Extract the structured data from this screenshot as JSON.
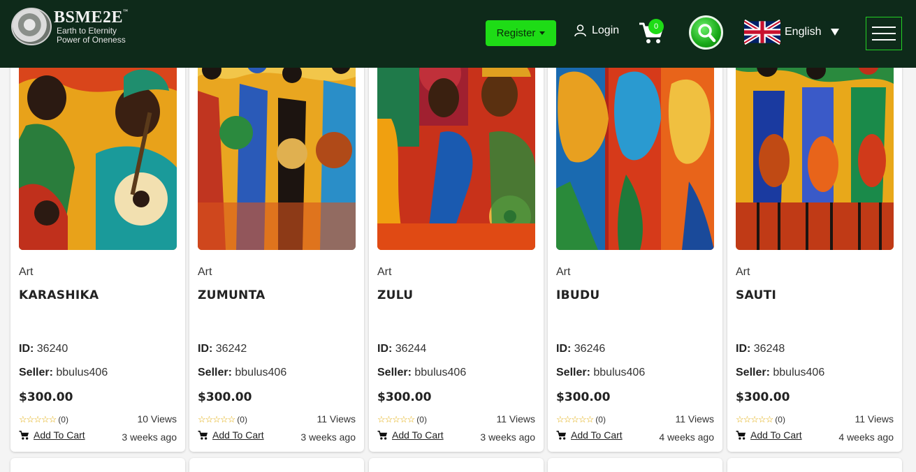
{
  "header": {
    "brand": "BSME2E",
    "tagline_1": "Earth to Eternity",
    "tagline_2": "Power of Oneness",
    "register_label": "Register",
    "login_label": "Login",
    "cart_count": "0",
    "language_label": "English"
  },
  "products": [
    {
      "category": "Art",
      "title": "KARASHIKA",
      "id_label": "ID:",
      "id": "36240",
      "seller_label": "Seller:",
      "seller": "bbulus406",
      "price": "$300.00",
      "rating_count": "(0)",
      "views": "10 Views",
      "add_to_cart": "Add To Cart",
      "posted": "3 weeks ago"
    },
    {
      "category": "Art",
      "title": "ZUMUNTA",
      "id_label": "ID:",
      "id": "36242",
      "seller_label": "Seller:",
      "seller": "bbulus406",
      "price": "$300.00",
      "rating_count": "(0)",
      "views": "11 Views",
      "add_to_cart": "Add To Cart",
      "posted": "3 weeks ago"
    },
    {
      "category": "Art",
      "title": "ZULU",
      "id_label": "ID:",
      "id": "36244",
      "seller_label": "Seller:",
      "seller": "bbulus406",
      "price": "$300.00",
      "rating_count": "(0)",
      "views": "11 Views",
      "add_to_cart": "Add To Cart",
      "posted": "3 weeks ago"
    },
    {
      "category": "Art",
      "title": "IBUDU",
      "id_label": "ID:",
      "id": "36246",
      "seller_label": "Seller:",
      "seller": "bbulus406",
      "price": "$300.00",
      "rating_count": "(0)",
      "views": "11 Views",
      "add_to_cart": "Add To Cart",
      "posted": "4 weeks ago"
    },
    {
      "category": "Art",
      "title": "SAUTI",
      "id_label": "ID:",
      "id": "36248",
      "seller_label": "Seller:",
      "seller": "bbulus406",
      "price": "$300.00",
      "rating_count": "(0)",
      "views": "11 Views",
      "add_to_cart": "Add To Cart",
      "posted": "4 weeks ago"
    }
  ],
  "colors": {
    "header_bg": "#0e2a1a",
    "accent_green": "#1edc16"
  },
  "icons": {
    "user": "user-icon",
    "cart": "cart-icon",
    "search": "search-icon",
    "flag": "uk-flag-icon",
    "menu": "hamburger-menu-icon",
    "star": "star-outline-icon"
  }
}
